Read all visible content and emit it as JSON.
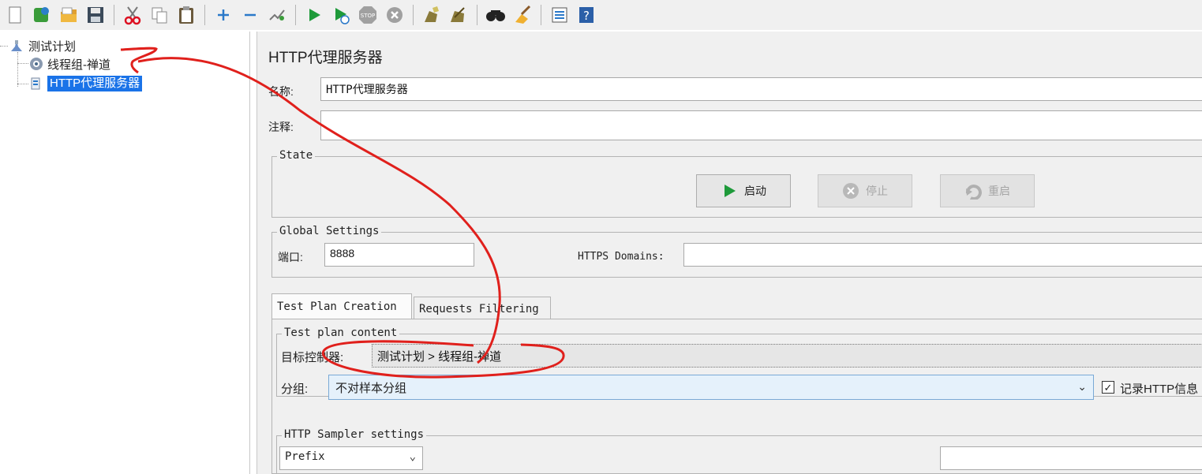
{
  "tree": {
    "items": [
      {
        "label": "测试计划"
      },
      {
        "label": "线程组-禅道"
      },
      {
        "label": "HTTP代理服务器"
      }
    ]
  },
  "panel": {
    "title": "HTTP代理服务器",
    "name_label": "名称:",
    "name_value": "HTTP代理服务器",
    "comment_label": "注释:",
    "comment_value": "",
    "state": {
      "title": "State",
      "start": "启动",
      "stop": "停止",
      "restart": "重启"
    },
    "global": {
      "title": "Global Settings",
      "port_label": "端口:",
      "port_value": "8888",
      "https_label": "HTTPS Domains:",
      "https_value": ""
    },
    "tabs": [
      {
        "label": "Test Plan Creation"
      },
      {
        "label": "Requests Filtering"
      }
    ],
    "content": {
      "title": "Test plan content",
      "target_label": "目标控制器:",
      "target_value": "测试计划 > 线程组-禅道",
      "group_label": "分组:",
      "group_value": "不对样本分组",
      "record_label": "记录HTTP信息",
      "record_checked": true
    },
    "sampler": {
      "title": "HTTP Sampler settings",
      "prefix_value": "Prefix"
    }
  },
  "colors": {
    "selection": "#1a73e8",
    "annotation": "#e0201c",
    "panel_bg": "#f0f0f0",
    "combo_bg": "#e5f1fb"
  }
}
